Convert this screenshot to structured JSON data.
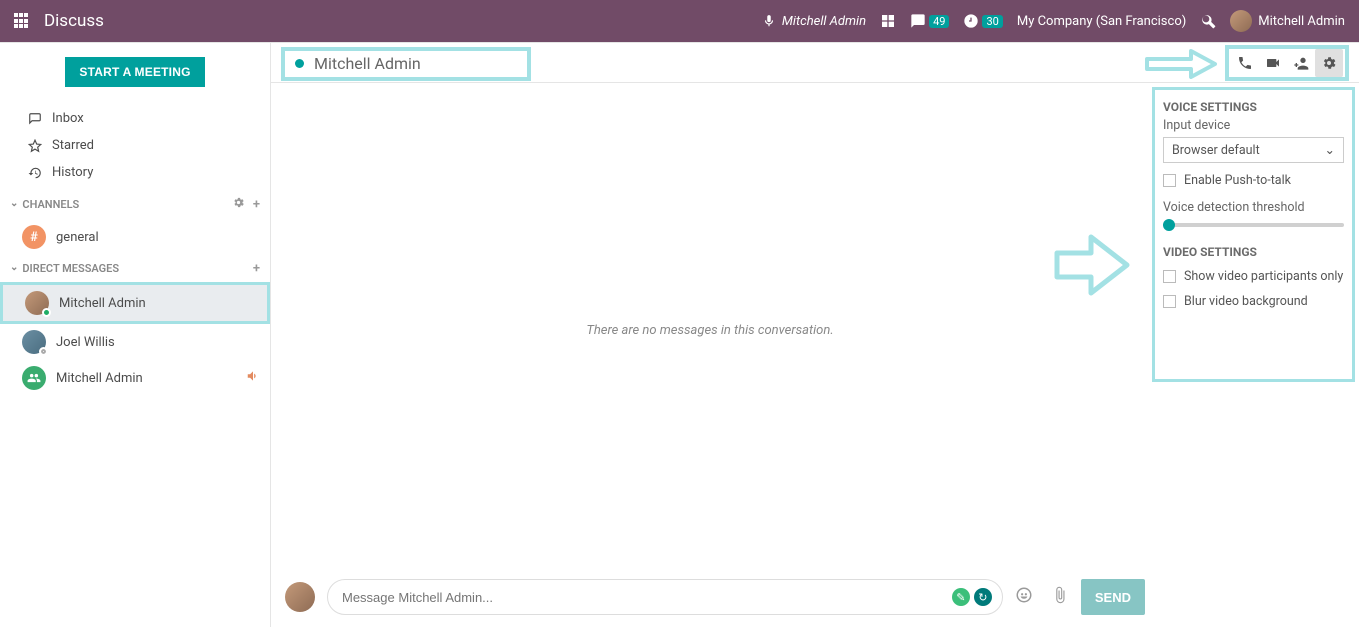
{
  "topbar": {
    "title": "Discuss",
    "user_menu_name": "Mitchell Admin",
    "mic_user": "Mitchell Admin",
    "chat_badge": "49",
    "clock_badge": "30",
    "company": "My Company (San Francisco)"
  },
  "sidebar": {
    "start_meeting": "START A MEETING",
    "nav": {
      "inbox": "Inbox",
      "starred": "Starred",
      "history": "History"
    },
    "channels_hdr": "CHANNELS",
    "channels": [
      {
        "name": "general"
      }
    ],
    "dm_hdr": "DIRECT MESSAGES",
    "dms": [
      {
        "name": "Mitchell Admin"
      },
      {
        "name": "Joel Willis"
      },
      {
        "name": "Mitchell Admin"
      }
    ]
  },
  "thread": {
    "title": "Mitchell Admin",
    "empty": "There are no messages in this conversation."
  },
  "settings": {
    "voice_hdr": "VOICE SETTINGS",
    "input_device_label": "Input device",
    "input_device_value": "Browser default",
    "push_to_talk": "Enable Push-to-talk",
    "threshold_label": "Voice detection threshold",
    "video_hdr": "VIDEO SETTINGS",
    "show_participants": "Show video participants only",
    "blur_bg": "Blur video background"
  },
  "composer": {
    "placeholder": "Message Mitchell Admin...",
    "send": "SEND"
  }
}
